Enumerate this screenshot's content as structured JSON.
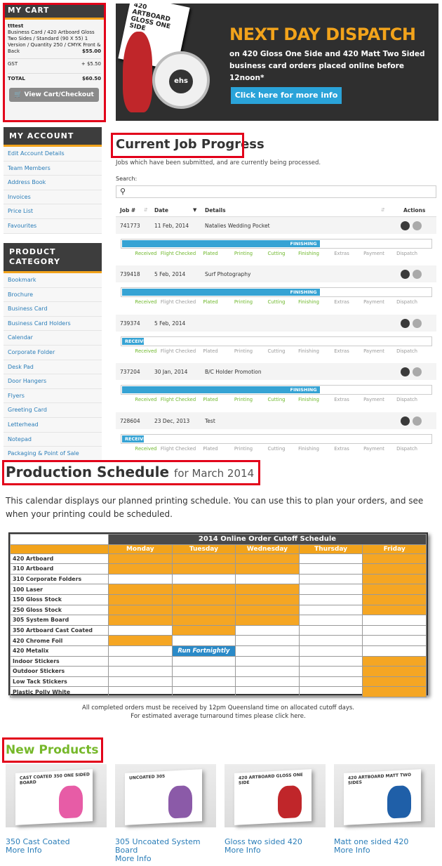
{
  "cart": {
    "title": "MY CART",
    "customer": "tttest",
    "item_desc": "Business Card / 420 Artboard Gloss Two Sides / Standard (90 X 55) 1 Version / Quantity 250 / CMYK Front & Back",
    "item_price": "$55.00",
    "gst_label": "GST",
    "gst_value": "+ $5.50",
    "total_label": "TOTAL",
    "total_value": "$60.50",
    "button": "View Cart/Checkout"
  },
  "account": {
    "title": "MY ACCOUNT",
    "links": [
      "Edit Account Details",
      "Team Members",
      "Address Book",
      "Invoices",
      "Price List",
      "Favourites"
    ]
  },
  "category": {
    "title": "PRODUCT CATEGORY",
    "links": [
      "Bookmark",
      "Brochure",
      "Business Card",
      "Business Card Holders",
      "Calendar",
      "Corporate Folder",
      "Desk Pad",
      "Door Hangers",
      "Flyers",
      "Greeting Card",
      "Letterhead",
      "Notepad",
      "Packaging & Point of Sale"
    ]
  },
  "banner": {
    "headline": "NEXT DAY DISPATCH",
    "text": "on 420 Gloss One Side and 420 Matt Two Sided business card orders placed online before 12noon*",
    "button": "Click here for more info",
    "card_text": "420 ARTBOARD GLOSS ONE SIDE",
    "clock_logo": "ehs"
  },
  "jobs": {
    "title": "Current Job Progress",
    "subtitle": "Jobs which have been submitted, and are currently being processed.",
    "search_label": "Search:",
    "search_value": "",
    "headers": {
      "job": "Job #",
      "date": "Date",
      "details": "Details",
      "actions": "Actions"
    },
    "steps": [
      "Received",
      "Flight Checked",
      "Plated",
      "Printing",
      "Cutting",
      "Finishing",
      "Extras",
      "Payment",
      "Dispatch"
    ],
    "rows": [
      {
        "id": "741773",
        "date": "11 Feb, 2014",
        "details": "Natalies Wedding Pocket",
        "status": "FINISHING",
        "progress": 0.64,
        "done": [
          0,
          1,
          2,
          3,
          4,
          5
        ]
      },
      {
        "id": "739418",
        "date": "5 Feb, 2014",
        "details": "Surf Photography",
        "status": "FINISHING",
        "progress": 0.64,
        "done": [
          0,
          2,
          3,
          4,
          5
        ]
      },
      {
        "id": "739374",
        "date": "5 Feb, 2014",
        "details": "",
        "status": "RECEIVED",
        "progress": 0.07,
        "done": [
          0
        ]
      },
      {
        "id": "737204",
        "date": "30 Jan, 2014",
        "details": "B/C Holder Promotion",
        "status": "FINISHING",
        "progress": 0.64,
        "done": [
          0,
          1,
          2,
          3,
          4,
          5
        ]
      },
      {
        "id": "728604",
        "date": "23 Dec, 2013",
        "details": "Test",
        "status": "RECEIVED",
        "progress": 0.07,
        "done": [
          0
        ]
      }
    ]
  },
  "schedule": {
    "title": "Production Schedule",
    "month": "for March 2014",
    "description": "This calendar displays our planned printing schedule. You can use this to plan your orders, and see when your printing could be scheduled.",
    "table_title": "2014 Online Order Cutoff Schedule",
    "days": [
      "Monday",
      "Tuesday",
      "Wednesday",
      "Thursday",
      "Friday"
    ],
    "fortnightly": "Run Fortnightly",
    "rows": [
      {
        "name": "420 Artboard",
        "cells": [
          1,
          1,
          1,
          0,
          1
        ]
      },
      {
        "name": "310 Artboard",
        "cells": [
          1,
          1,
          1,
          0,
          1
        ]
      },
      {
        "name": "310 Corporate Folders",
        "cells": [
          0,
          0,
          0,
          0,
          1
        ]
      },
      {
        "name": "100 Laser",
        "cells": [
          1,
          1,
          1,
          0,
          1
        ]
      },
      {
        "name": "150 Gloss Stock",
        "cells": [
          1,
          1,
          1,
          0,
          1
        ]
      },
      {
        "name": "250 Gloss Stock",
        "cells": [
          1,
          1,
          1,
          0,
          1
        ]
      },
      {
        "name": "305 System Board",
        "cells": [
          1,
          1,
          1,
          0,
          0
        ]
      },
      {
        "name": "350 Artboard Cast Coated",
        "cells": [
          0,
          1,
          0,
          0,
          0
        ]
      },
      {
        "name": "420 Chrome Foil",
        "cells": [
          1,
          0,
          0,
          0,
          0
        ]
      },
      {
        "name": "420 Metalix",
        "cells": [
          0,
          2,
          0,
          0,
          0
        ]
      },
      {
        "name": "Indoor Stickers",
        "cells": [
          0,
          0,
          0,
          0,
          1
        ]
      },
      {
        "name": "Outdoor Stickers",
        "cells": [
          0,
          0,
          0,
          0,
          1
        ]
      },
      {
        "name": "Low Tack Stickers",
        "cells": [
          0,
          0,
          0,
          0,
          1
        ]
      },
      {
        "name": "Plastic Polly White",
        "cells": [
          0,
          0,
          0,
          0,
          1
        ]
      }
    ],
    "note1": "All completed orders must be received by 12pm Queensland time on allocated cutoff days.",
    "note2": "For estimated average turnaround times please click here."
  },
  "new_products": {
    "title": "New Products",
    "more": "More Info",
    "items": [
      {
        "name": "350 Cast Coated",
        "card": "CAST COATED 350 ONE SIDED BOARD",
        "motif": "tulip"
      },
      {
        "name": "305 Uncoated System Board",
        "card": "UNCOATED 305",
        "motif": "handbag"
      },
      {
        "name": "Gloss two sided 420",
        "card": "420 ARTBOARD GLOSS ONE SIDE",
        "motif": "parrot"
      },
      {
        "name": "Matt one sided 420",
        "card": "420 ARTBOARD MATT TWO SIDES",
        "motif": "peacock"
      }
    ]
  },
  "colors": {
    "accent": "#f2a31b",
    "link": "#2a7db8",
    "done": "#6fb82c",
    "progress": "#36a3d4",
    "highlight": "#e2001a"
  }
}
